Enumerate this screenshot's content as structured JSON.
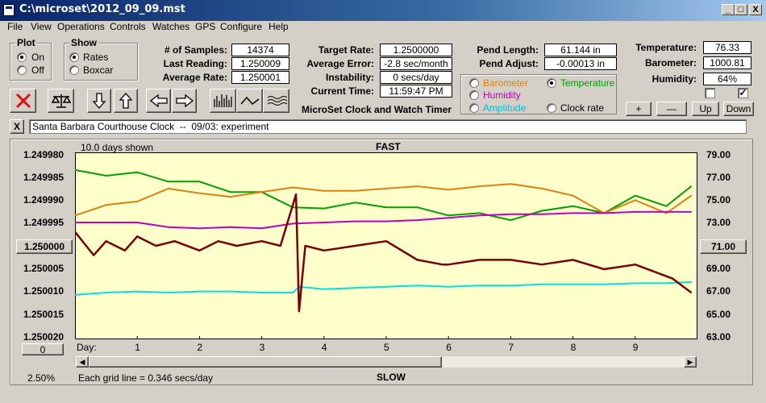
{
  "window": {
    "title": "C:\\microset\\2012_09_09.mst",
    "min": "_",
    "max": "□",
    "close": "X"
  },
  "menu": [
    "File",
    "View",
    "Operations",
    "Controls",
    "Watches",
    "GPS",
    "Configure",
    "Help"
  ],
  "plot_group": {
    "title": "Plot",
    "options": [
      "On",
      "Off"
    ],
    "selected": "On"
  },
  "show_group": {
    "title": "Show",
    "options": [
      "Rates",
      "Boxcar"
    ],
    "selected": "Rates"
  },
  "stats": {
    "samples_label": "# of Samples:",
    "samples": "14374",
    "last_reading_label": "Last Reading:",
    "last_reading": "1.250009",
    "average_rate_label": "Average Rate:",
    "average_rate": "1.250001",
    "target_rate_label": "Target Rate:",
    "target_rate": "1.2500000",
    "average_error_label": "Average Error:",
    "average_error": "-2.8 sec/month",
    "instability_label": "Instability:",
    "instability": "0 secs/day",
    "current_time_label": "Current Time:",
    "current_time": "11:59:47 PM",
    "pend_length_label": "Pend Length:",
    "pend_length": "61.144 in",
    "pend_adjust_label": "Pend Adjust:",
    "pend_adjust": "-0.00013 in",
    "temperature_label": "Temperature:",
    "temperature": "76.33",
    "barometer_label": "Barometer:",
    "barometer": "1000.81",
    "humidity_label": "Humidity:",
    "humidity": "64%"
  },
  "app_title": "MicroSet Clock and Watch Timer",
  "aux_options": {
    "items": [
      {
        "label": "Barometer",
        "color": "#e08010"
      },
      {
        "label": "Temperature",
        "color": "#00a000"
      },
      {
        "label": "Humidity",
        "color": "#c000c0"
      },
      {
        "label": "Amplitude",
        "color": "#00c0e0"
      },
      {
        "label": "Clock rate",
        "color": "#000000"
      }
    ],
    "selected": "Temperature"
  },
  "aux_buttons": {
    "plus": "+",
    "minus": "—",
    "up": "Up",
    "down": "Down"
  },
  "checkboxes": [
    {
      "checked": false
    },
    {
      "checked": true
    }
  ],
  "toolbar_icons": [
    "delete-icon",
    "balance-scale-icon",
    "arrow-down-icon",
    "arrow-up-icon",
    "arrow-left-icon",
    "arrow-right-icon",
    "bar-graph-icon",
    "line-graph-icon",
    "wave-graph-icon"
  ],
  "description": {
    "close": "X",
    "text": "Santa Barbara Courthouse Clock  --  09/03: experiment"
  },
  "chart": {
    "days_shown": "10.0 days shown",
    "fast_label": "FAST",
    "slow_label": "SLOW",
    "left_ticks": [
      "1.249980",
      "1.249985",
      "1.249990",
      "1.249995",
      "1.250005",
      "1.250010",
      "1.250015",
      "1.250020"
    ],
    "left_button": "1.250000",
    "right_ticks": [
      "79.00",
      "77.00",
      "75.00",
      "73.00",
      "69.00",
      "67.00",
      "65.00",
      "63.00"
    ],
    "right_button": "71.00",
    "zero_button": "0",
    "day_label": "Day:",
    "day_ticks": [
      "1",
      "2",
      "3",
      "4",
      "5",
      "6",
      "7",
      "8",
      "9"
    ],
    "zoom": "2.50%",
    "grid_note": "Each grid line = 0.346 secs/day",
    "bg_color": "#ffffcc"
  },
  "chart_data": {
    "type": "line",
    "xlabel": "Day:",
    "xlim": [
      0,
      10
    ],
    "y_left_lim": [
      1.24998,
      1.25002
    ],
    "y_right_lim": [
      63,
      79
    ],
    "series": [
      {
        "name": "Clock rate",
        "color": "#7a0000",
        "axis": "left",
        "x": [
          0,
          0.3,
          0.5,
          0.8,
          1,
          1.3,
          1.6,
          2,
          2.3,
          2.6,
          3,
          3.3,
          3.55,
          3.6,
          3.7,
          4,
          4.5,
          5,
          5.5,
          5.9,
          6,
          6.5,
          7,
          7.5,
          8,
          8.5,
          9,
          9.4,
          9.6,
          9.8,
          9.9
        ],
        "y": [
          1.249997,
          1.250002,
          1.249999,
          1.250001,
          1.249998,
          1.25,
          1.249999,
          1.250001,
          1.249999,
          1.25,
          1.249999,
          1.25,
          1.249989,
          1.250014,
          1.25,
          1.250001,
          1.25,
          1.249999,
          1.250003,
          1.250004,
          1.250004,
          1.250003,
          1.250003,
          1.250004,
          1.250003,
          1.250005,
          1.250004,
          1.250006,
          1.250007,
          1.250009,
          1.25001
        ]
      },
      {
        "name": "Temperature",
        "color": "#00a000",
        "axis": "right",
        "x": [
          0,
          0.5,
          1,
          1.5,
          2,
          2.5,
          3,
          3.5,
          4,
          4.5,
          5,
          5.5,
          6,
          6.5,
          7,
          7.5,
          8,
          8.5,
          9,
          9.5,
          9.9
        ],
        "y": [
          77.5,
          77.0,
          77.3,
          76.5,
          76.5,
          75.6,
          75.6,
          74.3,
          74.2,
          74.7,
          74.3,
          74.3,
          73.6,
          73.8,
          73.2,
          74.0,
          74.4,
          73.8,
          75.3,
          74.4,
          76.1
        ]
      },
      {
        "name": "Barometer",
        "color": "#e08010",
        "axis": "right",
        "x": [
          0,
          0.5,
          1,
          1.5,
          2,
          2.5,
          3,
          3.5,
          4,
          4.5,
          5,
          5.5,
          6,
          6.5,
          7,
          7.5,
          8,
          8.5,
          9,
          9.5,
          9.9
        ],
        "y": [
          73.6,
          74.5,
          74.8,
          75.9,
          75.5,
          75.2,
          75.6,
          76.0,
          75.7,
          75.7,
          75.9,
          76.1,
          75.8,
          76.1,
          76.3,
          75.9,
          75.3,
          73.8,
          74.9,
          73.8,
          75.3
        ]
      },
      {
        "name": "Humidity",
        "color": "#c000c0",
        "axis": "right",
        "x": [
          0,
          0.5,
          1,
          1.5,
          2,
          2.5,
          3,
          3.5,
          4,
          4.5,
          5,
          5.5,
          6,
          6.5,
          7,
          7.5,
          8,
          8.5,
          9,
          9.5,
          9.9
        ],
        "y": [
          73.0,
          73.0,
          73.0,
          72.6,
          72.5,
          72.6,
          72.5,
          72.9,
          73.0,
          73.1,
          73.1,
          73.2,
          73.4,
          73.6,
          73.7,
          73.7,
          73.8,
          73.8,
          73.9,
          73.9,
          73.9
        ]
      },
      {
        "name": "Amplitude",
        "color": "#00e0e0",
        "axis": "right",
        "x": [
          0,
          0.5,
          1,
          1.5,
          2,
          2.5,
          3,
          3.5,
          3.6,
          4,
          4.5,
          5,
          5.5,
          6,
          6.5,
          7,
          7.5,
          8,
          8.5,
          9,
          9.5,
          9.9
        ],
        "y": [
          66.8,
          67.0,
          67.1,
          67.0,
          67.1,
          67.1,
          67.0,
          67.0,
          67.5,
          67.3,
          67.4,
          67.5,
          67.6,
          67.5,
          67.6,
          67.6,
          67.7,
          67.7,
          67.7,
          67.8,
          67.8,
          67.9
        ]
      }
    ]
  }
}
